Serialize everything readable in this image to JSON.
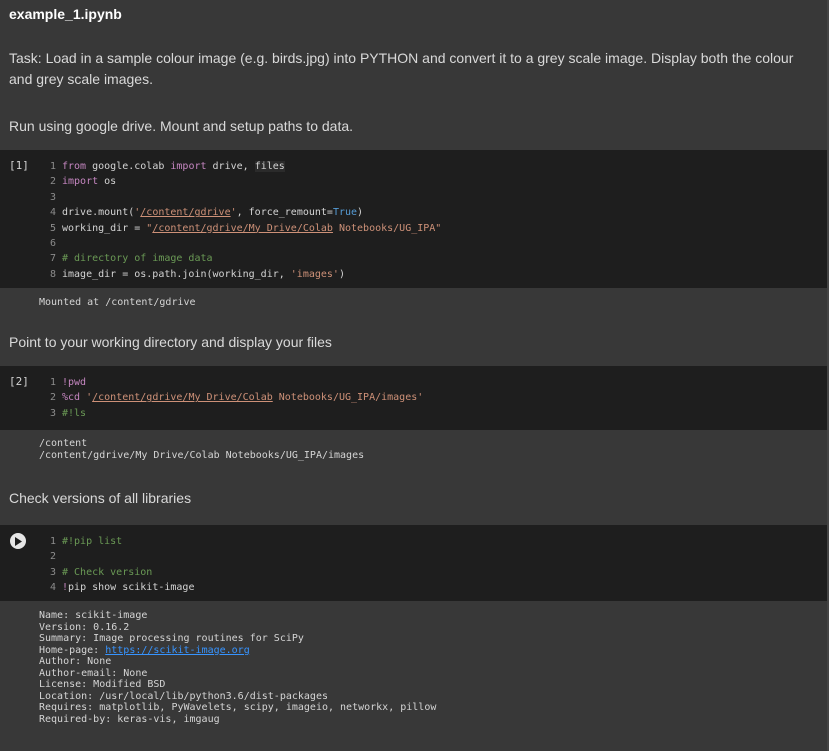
{
  "notebook": {
    "filename": "example_1.ipynb"
  },
  "cells": {
    "md1": "Task: Load in a sample colour image (e.g. birds.jpg) into PYTHON and convert it to a grey scale image. Display both the colour and grey scale images.",
    "md2": "Run using google drive. Mount and setup paths to data.",
    "code1": {
      "prompt": "[1]",
      "lines": [
        "from google.colab import drive, files",
        "import os",
        "",
        "drive.mount('/content/gdrive', force_remount=True)",
        "working_dir = \"/content/gdrive/My Drive/Colab Notebooks/UG_IPA\"",
        "",
        "# directory of image data",
        "image_dir = os.path.join(working_dir, 'images')"
      ],
      "output": "Mounted at /content/gdrive"
    },
    "md3": "Point to your working directory and display your files",
    "code2": {
      "prompt": "[2]",
      "lines": [
        "!pwd",
        "%cd '/content/gdrive/My Drive/Colab Notebooks/UG_IPA/images'",
        "#!ls"
      ],
      "output": [
        "/content",
        "/content/gdrive/My Drive/Colab Notebooks/UG_IPA/images"
      ]
    },
    "md4": "Check versions of all libraries",
    "code3": {
      "run_icon": "play-icon",
      "lines": [
        "#!pip list",
        "",
        "# Check version",
        "!pip show scikit-image"
      ],
      "output": [
        "Name: scikit-image",
        "Version: 0.16.2",
        "Summary: Image processing routines for SciPy",
        "Home-page: ",
        "Author: None",
        "Author-email: None",
        "License: Modified BSD",
        "Location: /usr/local/lib/python3.6/dist-packages",
        "Requires: matplotlib, PyWavelets, scipy, imageio, networkx, pillow",
        "Required-by: keras-vis, imgaug"
      ],
      "homepage_url": "https://scikit-image.org"
    }
  }
}
